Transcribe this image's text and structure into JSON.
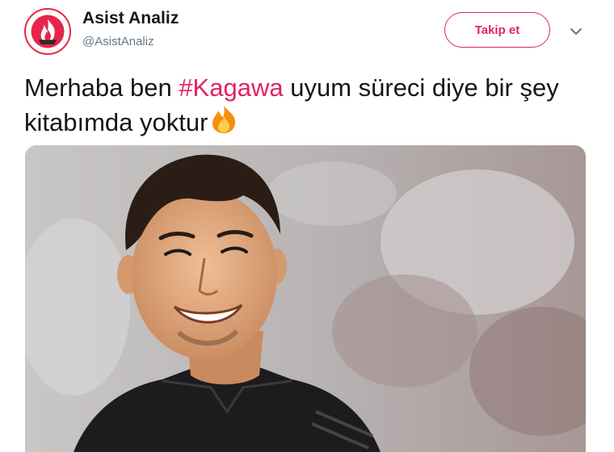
{
  "account": {
    "name": "Asist Analiz",
    "handle": "@AsistAnaliz",
    "avatar_icon": "flame-logo-icon",
    "brand_color": "#e8244a"
  },
  "follow_button": {
    "label": "Takip et",
    "color": "#e0245e"
  },
  "menu_caret_icon": "chevron-down-icon",
  "tweet": {
    "text_before": "Merhaba ben ",
    "hashtag": "#Kagawa",
    "text_after": " uyum süreci diye bir şey kitabımda yoktur",
    "emoji_icon": "fire-emoji",
    "hashtag_color": "#e0245e"
  },
  "media": {
    "type": "photo",
    "subject_icon": "smiling-footballer-photo"
  }
}
